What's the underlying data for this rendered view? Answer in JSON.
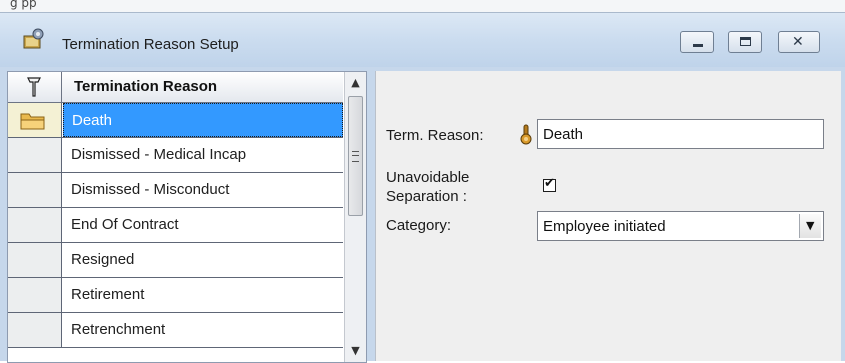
{
  "background_strip": {
    "text": "g              pp"
  },
  "window": {
    "title": "Termination Reason Setup",
    "icon": "setup-gear-icon",
    "controls": {
      "minimize": "minimize",
      "maximize": "maximize",
      "close": "close"
    }
  },
  "grid": {
    "header_icon": "tool-icon",
    "header": "Termination Reason",
    "selected_index": 0,
    "rows": [
      {
        "label": "Death",
        "selected": true,
        "icon": "folder-icon"
      },
      {
        "label": "Dismissed - Medical Incap"
      },
      {
        "label": "Dismissed - Misconduct"
      },
      {
        "label": "End Of Contract"
      },
      {
        "label": "Resigned"
      },
      {
        "label": "Retirement"
      },
      {
        "label": "Retrenchment"
      }
    ],
    "scrollbar": {
      "up": "▲",
      "down": "▼",
      "grip": "≡"
    }
  },
  "form": {
    "term_reason_label": "Term. Reason:",
    "term_reason_value": "Death",
    "required_icon": "key-icon",
    "unavoidable_label_line1": "Unavoidable",
    "unavoidable_label_line2": "Separation :",
    "unavoidable_checked": true,
    "check_glyph": "✔",
    "category_label": "Category:",
    "category_value": "Employee initiated",
    "category_arrow": "▼"
  },
  "colors": {
    "titlebar": "#cbdcef",
    "selection": "#3399ff",
    "form_bg": "#efefef",
    "grid_lines": "#5e6676"
  }
}
